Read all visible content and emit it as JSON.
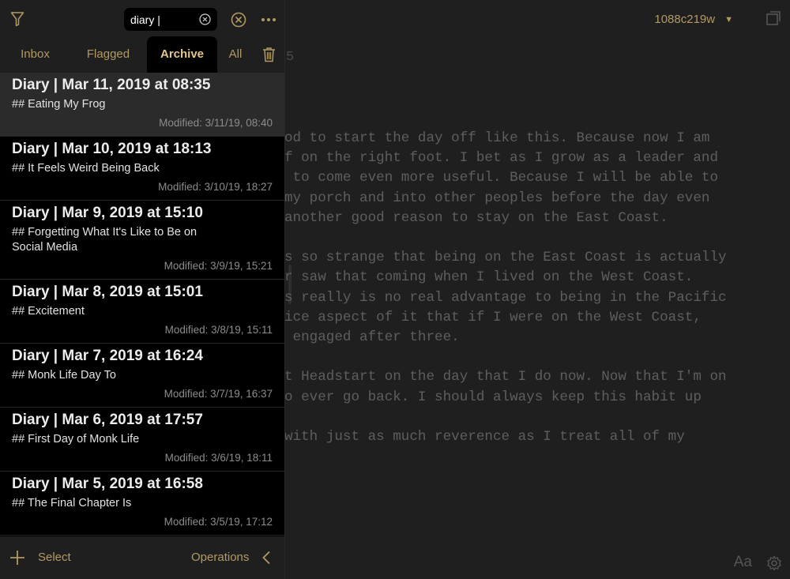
{
  "colors": {
    "accent": "#b29a62",
    "sidebar_bg": "#000000",
    "editor_bg": "#1f1f1f",
    "selected_row": "#2b2b2b"
  },
  "toolbar": {
    "filter_icon": "filter-icon",
    "search_value": "diary |",
    "clear_icon": "clear-icon",
    "cancel_icon": "cancel-circle-icon",
    "more_icon": "more-icon"
  },
  "tabs": [
    {
      "label": "Inbox",
      "active": false
    },
    {
      "label": "Flagged",
      "active": false
    },
    {
      "label": "Archive",
      "active": true
    },
    {
      "label": "All",
      "active": false
    }
  ],
  "notes": [
    {
      "title": "Diary | Mar 11, 2019 at 08:35",
      "excerpt": "## Eating My Frog",
      "modified": "Modified: 3/11/19, 08:40",
      "selected": true
    },
    {
      "title": "Diary | Mar 10, 2019 at 18:13",
      "excerpt": "## It Feels Weird Being Back",
      "modified": "Modified: 3/10/19, 18:27"
    },
    {
      "title": "Diary | Mar 9, 2019 at 15:10",
      "excerpt": "## Forgetting What It's Like to Be on Social Media",
      "modified": "Modified: 3/9/19, 15:21"
    },
    {
      "title": "Diary | Mar 8, 2019 at 15:01",
      "excerpt": "## Excitement",
      "modified": "Modified: 3/8/19, 15:11"
    },
    {
      "title": "Diary | Mar 7, 2019 at 16:24",
      "excerpt": "## Monk Life Day To",
      "modified": "Modified: 3/7/19, 16:37"
    },
    {
      "title": "Diary | Mar 6, 2019 at 17:57",
      "excerpt": "## First Day of Monk Life",
      "modified": "Modified: 3/6/19, 18:11"
    },
    {
      "title": "Diary | Mar 5, 2019 at 16:58",
      "excerpt": "## The Final Chapter Is",
      "modified": "Modified: 3/5/19, 17:12"
    }
  ],
  "bottombar": {
    "select_label": "Select",
    "operations_label": "Operations"
  },
  "editor": {
    "note_id": "1088c219w",
    "top_char": "5",
    "lines": [
      "od to start the day off like this. Because now I am",
      "f on the right foot. I bet as I grow as a leader and",
      " to come even more useful. Because I will be able to",
      "my porch and into other peoples before the day even",
      "another good reason to stay on the East Coast.",
      "",
      "s so strange that being on the East Coast is actually",
      "r saw that coming when I lived on the West Coast.",
      "s really is no real advantage to being in the Pacific",
      "ice aspect of it that if I were on the West Coast,",
      " engaged after three.",
      "",
      "t Headstart on the day that I do now. Now that I'm on",
      "o ever go back. I should always keep this habit up",
      "",
      "with just as much reverence as I treat all of my"
    ],
    "font_button": "Aa"
  }
}
